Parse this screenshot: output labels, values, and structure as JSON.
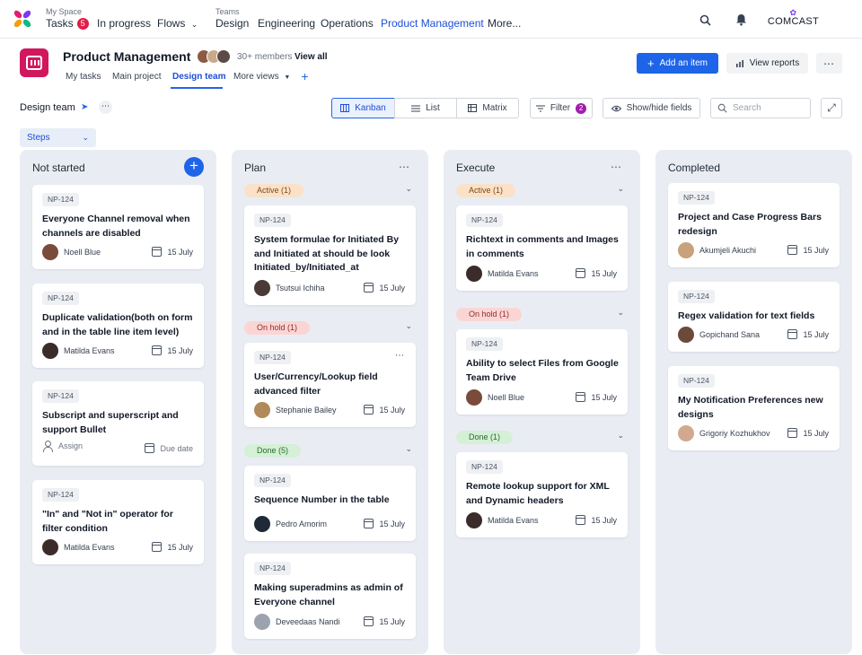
{
  "topbar": {
    "my_space_label": "My Space",
    "tasks": "Tasks",
    "tasks_badge": "5",
    "in_progress": "In progress",
    "flows": "Flows",
    "teams_label": "Teams",
    "teams": [
      "Design",
      "Engineering",
      "Operations",
      "Product Management",
      "More..."
    ],
    "brand": "COMCAST"
  },
  "header": {
    "title": "Product Management",
    "members": "30+ members",
    "view_all": "View all",
    "tabs": [
      "My tasks",
      "Main project",
      "Design team",
      "More views"
    ],
    "add_item": "Add an item",
    "view_reports": "View reports"
  },
  "toolbar": {
    "view_name": "Design team",
    "views": [
      "Kanban",
      "List",
      "Matrix"
    ],
    "filter": "Filter",
    "filter_count": "2",
    "show_hide": "Show/hide fields",
    "search_placeholder": "Search",
    "steps": "Steps"
  },
  "columns": {
    "not_started": {
      "title": "Not started",
      "cards": [
        {
          "id": "NP-124",
          "title": "Everyone Channel removal when channels are disabled",
          "person": "Noell Blue",
          "due": "15 July"
        },
        {
          "id": "NP-124",
          "title": "Duplicate validation(both on form and in the table line item level)",
          "person": "Matilda Evans",
          "due": "15 July"
        },
        {
          "id": "NP-124",
          "title": "Subscript and superscript  and support Bullet",
          "person": "Assign",
          "due": "Due date"
        },
        {
          "id": "NP-124",
          "title": "\"In\" and \"Not in\" operator for filter condition",
          "person": "Matilda Evans",
          "due": "15 July"
        }
      ]
    },
    "plan": {
      "title": "Plan",
      "groups": [
        "Active (1)",
        "On hold (1)",
        "Done (5)"
      ],
      "cards": [
        {
          "id": "NP-124",
          "title": "System formulae for Initiated By and Initiated at should be look Initiated_by/Initiated_at",
          "person": "Tsutsui Ichiha",
          "due": "15 July"
        },
        {
          "id": "NP-124",
          "title": "User/Currency/Lookup field advanced filter",
          "person": "Stephanie Bailey",
          "due": "15 July"
        },
        {
          "id": "NP-124",
          "title": "Sequence Number in the table",
          "person": "Pedro Amorim",
          "due": "15 July"
        },
        {
          "id": "NP-124",
          "title": "Making superadmins as admin of Everyone channel",
          "person": "Deveedaas Nandi",
          "due": "15 July"
        }
      ]
    },
    "execute": {
      "title": "Execute",
      "groups": [
        "Active (1)",
        "On hold (1)",
        "Done (1)"
      ],
      "cards": [
        {
          "id": "NP-124",
          "title": "Richtext in comments and Images in comments",
          "person": "Matilda Evans",
          "due": "15 July"
        },
        {
          "id": "NP-124",
          "title": "Ability to select Files from Google Team Drive",
          "person": "Noell Blue",
          "due": "15 July"
        },
        {
          "id": "NP-124",
          "title": "Remote lookup support for XML and Dynamic headers",
          "person": "Matilda Evans",
          "due": "15 July"
        }
      ]
    },
    "completed": {
      "title": "Completed",
      "cards": [
        {
          "id": "NP-124",
          "title": "Project and Case Progress Bars redesign",
          "person": "Akumjeli Akuchi",
          "due": "15 July"
        },
        {
          "id": "NP-124",
          "title": "Regex validation for text fields",
          "person": "Gopichand Sana",
          "due": "15 July"
        },
        {
          "id": "NP-124",
          "title": "My Notification Preferences new designs",
          "person": "Grigoriy Kozhukhov",
          "due": "15 July"
        }
      ]
    }
  },
  "colors": {
    "accent": "#1d64e8",
    "app_icon": "#d1175e",
    "column_bg": "#e9edf3",
    "pill_active": "#fbe1c8",
    "pill_on_hold": "#fbd5d3",
    "pill_done": "#d5f0d6"
  }
}
